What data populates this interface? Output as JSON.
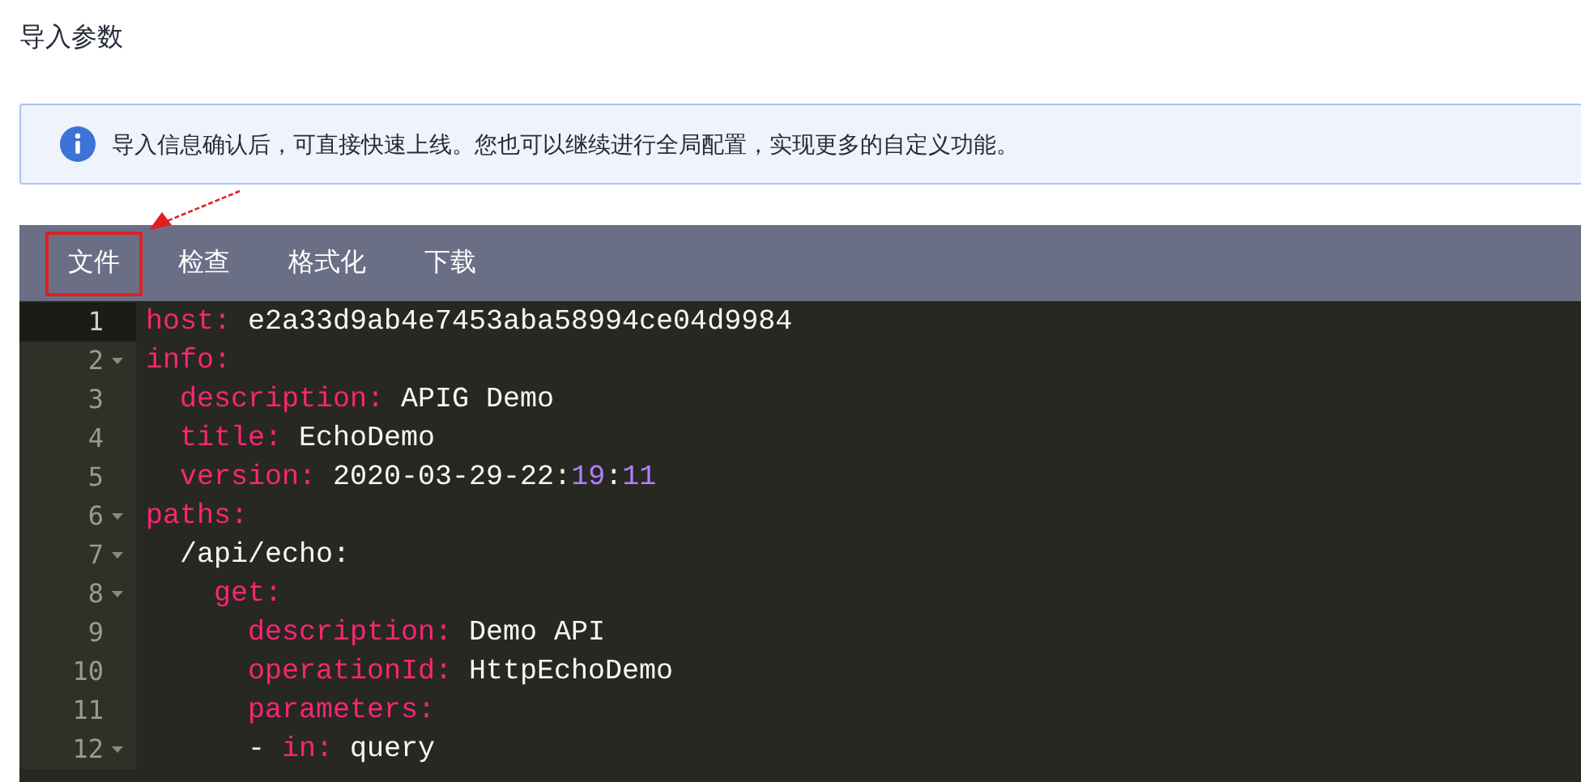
{
  "page_title": "导入参数",
  "notice": {
    "text": "导入信息确认后，可直接快速上线。您也可以继续进行全局配置，实现更多的自定义功能。"
  },
  "editor": {
    "toolbar": [
      {
        "label": "文件",
        "annotated": true
      },
      {
        "label": "检查",
        "annotated": false
      },
      {
        "label": "格式化",
        "annotated": false
      },
      {
        "label": "下载",
        "annotated": false
      }
    ],
    "lines": [
      {
        "number": "1",
        "active": true,
        "foldable": false,
        "tokens": [
          {
            "kind": "key",
            "text": "host:"
          },
          {
            "kind": "value",
            "text": " e2a33d9ab4e7453aba58994ce04d9984"
          }
        ]
      },
      {
        "number": "2",
        "active": false,
        "foldable": true,
        "tokens": [
          {
            "kind": "key",
            "text": "info:"
          }
        ]
      },
      {
        "number": "3",
        "active": false,
        "foldable": false,
        "tokens": [
          {
            "kind": "key",
            "text": "  description:"
          },
          {
            "kind": "value",
            "text": " APIG Demo"
          }
        ]
      },
      {
        "number": "4",
        "active": false,
        "foldable": false,
        "tokens": [
          {
            "kind": "key",
            "text": "  title:"
          },
          {
            "kind": "value",
            "text": " EchoDemo"
          }
        ]
      },
      {
        "number": "5",
        "active": false,
        "foldable": false,
        "tokens": [
          {
            "kind": "key",
            "text": "  version:"
          },
          {
            "kind": "value",
            "text": " 2020-03-29-22:"
          },
          {
            "kind": "number",
            "text": "19"
          },
          {
            "kind": "value",
            "text": ":"
          },
          {
            "kind": "number",
            "text": "11"
          }
        ]
      },
      {
        "number": "6",
        "active": false,
        "foldable": true,
        "tokens": [
          {
            "kind": "key",
            "text": "paths:"
          }
        ]
      },
      {
        "number": "7",
        "active": false,
        "foldable": true,
        "tokens": [
          {
            "kind": "value",
            "text": "  /api/echo:"
          }
        ]
      },
      {
        "number": "8",
        "active": false,
        "foldable": true,
        "tokens": [
          {
            "kind": "key",
            "text": "    get:"
          }
        ]
      },
      {
        "number": "9",
        "active": false,
        "foldable": false,
        "tokens": [
          {
            "kind": "key",
            "text": "      description:"
          },
          {
            "kind": "value",
            "text": " Demo API"
          }
        ]
      },
      {
        "number": "10",
        "active": false,
        "foldable": false,
        "tokens": [
          {
            "kind": "key",
            "text": "      operationId:"
          },
          {
            "kind": "value",
            "text": " HttpEchoDemo"
          }
        ]
      },
      {
        "number": "11",
        "active": false,
        "foldable": false,
        "tokens": [
          {
            "kind": "key",
            "text": "      parameters:"
          }
        ]
      },
      {
        "number": "12",
        "active": false,
        "foldable": true,
        "tokens": [
          {
            "kind": "value",
            "text": "      - "
          },
          {
            "kind": "key",
            "text": "in:"
          },
          {
            "kind": "value",
            "text": " query"
          }
        ]
      }
    ]
  }
}
